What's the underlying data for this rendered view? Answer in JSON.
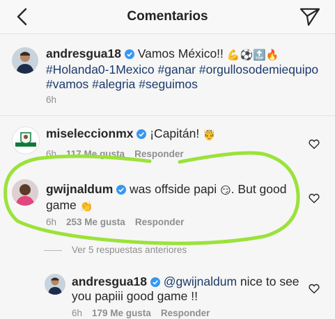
{
  "header": {
    "title": "Comentarios"
  },
  "post": {
    "username": "andresgua18",
    "caption": "Vamos México!!",
    "hashtags_line1": "#Holanda0-1Mexico #ganar #orgullosodemiequipo",
    "hashtags_line2": "#vamos #alegria #seguimos",
    "time": "6h",
    "emoji": {
      "muscle": "💪",
      "ball": "⚽",
      "top": "🔝",
      "fire": "🔥"
    }
  },
  "comments": [
    {
      "username": "miseleccionmx",
      "text": "¡Capitán!",
      "emoji": "🤴",
      "time": "6h",
      "likes": "117 Me gusta",
      "reply": "Responder"
    },
    {
      "username": "gwijnaldum",
      "text_part1": "was offside papi",
      "emoji1": "😏",
      "text_part2": ". But good",
      "text_line2": "game",
      "emoji2": "👏",
      "time": "6h",
      "likes": "253 Me gusta",
      "reply": "Responder"
    }
  ],
  "view_replies": "Ver 5 respuestas anteriores",
  "reply": {
    "username": "andresgua18",
    "mention": "@gwijnaldum",
    "text_line1": "nice to see",
    "text_line2": "you papiii good game !!",
    "time": "6h",
    "likes": "179 Me gusta",
    "reply": "Responder"
  },
  "colors": {
    "annotation": "#9be23a",
    "verified": "#3897f0",
    "hashtag": "#1b3a6b"
  }
}
